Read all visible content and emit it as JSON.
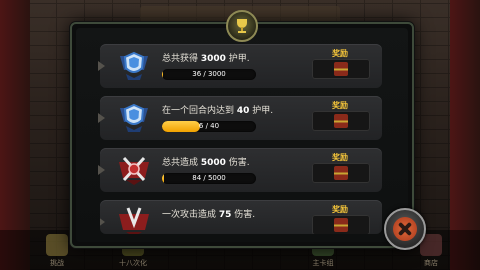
{
  "achievements": [
    {
      "title_pre": "总共获得 ",
      "title_num": "3000",
      "title_post": " 护甲.",
      "progress_text": "36 / 3000",
      "progress": 0.012,
      "reward_label": "奖励",
      "medal": "blue-shield-medal-icon"
    },
    {
      "title_pre": "在一个回合内达到 ",
      "title_num": "40",
      "title_post": " 护甲.",
      "progress_text": "6 / 40",
      "progress": 0.15,
      "reward_label": "奖励",
      "medal": "blue-shield-medal-icon"
    },
    {
      "title_pre": "总共造成 ",
      "title_num": "5000",
      "title_post": " 伤害.",
      "progress_text": "84 / 5000",
      "progress": 0.017,
      "reward_label": "奖励",
      "medal": "red-swords-medal-icon"
    },
    {
      "title_pre": "一次攻击造成 ",
      "title_num": "75",
      "title_post": " 伤害.",
      "progress_text": "",
      "progress": 0.0,
      "reward_label": "奖励",
      "medal": "red-swords-medal-icon"
    }
  ],
  "bottom_nav": [
    "挑战",
    "十八次化",
    "",
    "主卡组",
    "商店"
  ],
  "colors": {
    "accent": "#f2c33a",
    "bar_fill": "#f5b01a"
  }
}
